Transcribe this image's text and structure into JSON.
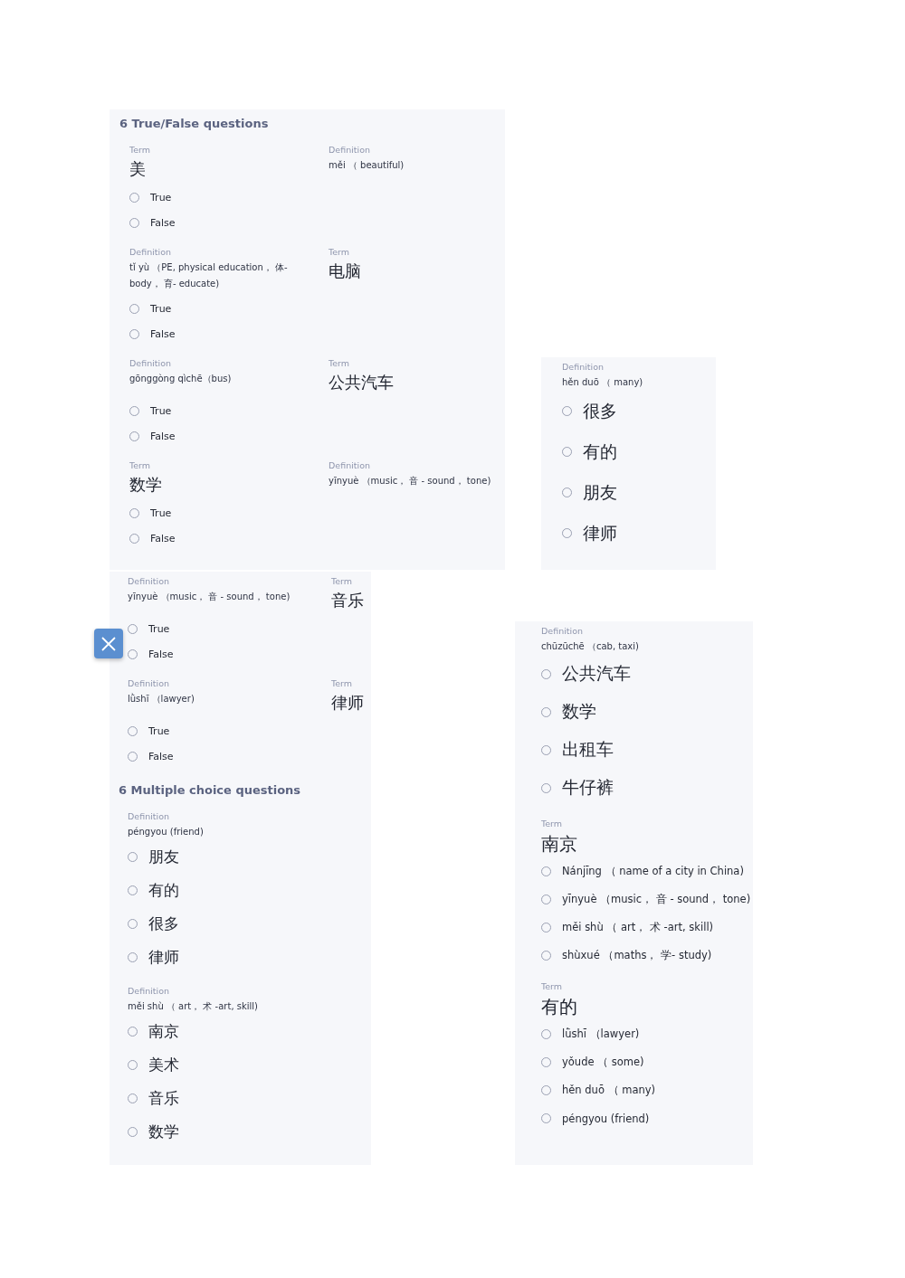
{
  "panels": [
    {
      "heading": "6 True/False questions",
      "questions": [
        {
          "kind": "true_false",
          "left": {
            "kind": "term",
            "label": "Term",
            "text": "美"
          },
          "right": {
            "kind": "definition",
            "label": "Definition",
            "text": "měi （ beautiful)"
          },
          "options": [
            {
              "text": "True",
              "selected": false
            },
            {
              "text": "False",
              "selected": false
            }
          ]
        },
        {
          "kind": "true_false",
          "left": {
            "kind": "definition",
            "label": "Definition",
            "text": "tǐ yù （PE, physical education， 体-body， 育- educate)"
          },
          "right": {
            "kind": "term",
            "label": "Term",
            "text": "电脑"
          },
          "options": [
            {
              "text": "True",
              "selected": false
            },
            {
              "text": "False",
              "selected": false
            }
          ]
        },
        {
          "kind": "true_false",
          "left": {
            "kind": "definition",
            "label": "Definition",
            "text": "gōnggòng qìchē（bus)"
          },
          "right": {
            "kind": "term",
            "label": "Term",
            "text": "公共汽车"
          },
          "options": [
            {
              "text": "True",
              "selected": false
            },
            {
              "text": "False",
              "selected": false
            }
          ]
        },
        {
          "kind": "true_false",
          "left": {
            "kind": "term",
            "label": "Term",
            "text": "数学"
          },
          "right": {
            "kind": "definition",
            "label": "Definition",
            "text": "yīnyuè （music， 音 - sound， tone)"
          },
          "options": [
            {
              "text": "True",
              "selected": false
            },
            {
              "text": "False",
              "selected": false
            }
          ]
        }
      ]
    },
    {
      "questions": [
        {
          "kind": "true_false",
          "left": {
            "kind": "definition",
            "label": "Definition",
            "text": "yīnyuè （music， 音 - sound， tone)"
          },
          "right": {
            "kind": "term",
            "label": "Term",
            "text": "音乐"
          },
          "options": [
            {
              "text": "True",
              "selected": false
            },
            {
              "text": "False",
              "selected": false
            }
          ]
        },
        {
          "kind": "true_false",
          "left": {
            "kind": "definition",
            "label": "Definition",
            "text": "lǜshī （lawyer)"
          },
          "right": {
            "kind": "term",
            "label": "Term",
            "text": "律师"
          },
          "options": [
            {
              "text": "True",
              "selected": false
            },
            {
              "text": "False",
              "selected": false
            }
          ]
        },
        {
          "kind": "heading",
          "text": "6 Multiple choice questions"
        },
        {
          "kind": "multiple_choice",
          "prompt": {
            "kind": "definition",
            "label": "Definition",
            "text": "péngyou (friend)"
          },
          "options": [
            {
              "text": "朋友",
              "selected": false
            },
            {
              "text": "有的",
              "selected": false
            },
            {
              "text": "很多",
              "selected": false
            },
            {
              "text": "律师",
              "selected": false
            }
          ]
        },
        {
          "kind": "multiple_choice",
          "prompt": {
            "kind": "definition",
            "label": "Definition",
            "text": "měi shù （ art， 术 -art, skill)"
          },
          "options": [
            {
              "text": "南京",
              "selected": false
            },
            {
              "text": "美术",
              "selected": false
            },
            {
              "text": "音乐",
              "selected": false
            },
            {
              "text": "数学",
              "selected": false
            }
          ]
        }
      ]
    },
    {
      "questions": [
        {
          "kind": "multiple_choice",
          "prompt": {
            "kind": "definition",
            "label": "Definition",
            "text": "hěn duō （ many)"
          },
          "options": [
            {
              "text": "很多",
              "selected": false
            },
            {
              "text": "有的",
              "selected": false
            },
            {
              "text": "朋友",
              "selected": false
            },
            {
              "text": "律师",
              "selected": false
            }
          ]
        }
      ]
    },
    {
      "questions": [
        {
          "kind": "multiple_choice",
          "prompt": {
            "kind": "definition",
            "label": "Definition",
            "text": "chūzūchē （cab, taxi)"
          },
          "options": [
            {
              "text": "公共汽车",
              "selected": false
            },
            {
              "text": "数学",
              "selected": false
            },
            {
              "text": "出租车",
              "selected": false
            },
            {
              "text": "牛仔裤",
              "selected": false
            }
          ]
        },
        {
          "kind": "multiple_choice",
          "prompt": {
            "kind": "term",
            "label": "Term",
            "text": "南京"
          },
          "options": [
            {
              "text": "Nánjīng （ name of a city in China)",
              "selected": false
            },
            {
              "text": "yīnyuè （music， 音 - sound， tone)",
              "selected": false
            },
            {
              "text": "měi shù （ art， 术 -art, skill)",
              "selected": false
            },
            {
              "text": "shùxué （maths， 学- study)",
              "selected": false
            }
          ]
        },
        {
          "kind": "multiple_choice",
          "prompt": {
            "kind": "term",
            "label": "Term",
            "text": "有的"
          },
          "options": [
            {
              "text": "lǜshī （lawyer)",
              "selected": false
            },
            {
              "text": "yǒude （ some)",
              "selected": false
            },
            {
              "text": "hěn duō （ many)",
              "selected": false
            },
            {
              "text": "péngyou (friend)",
              "selected": false
            }
          ]
        }
      ]
    }
  ]
}
